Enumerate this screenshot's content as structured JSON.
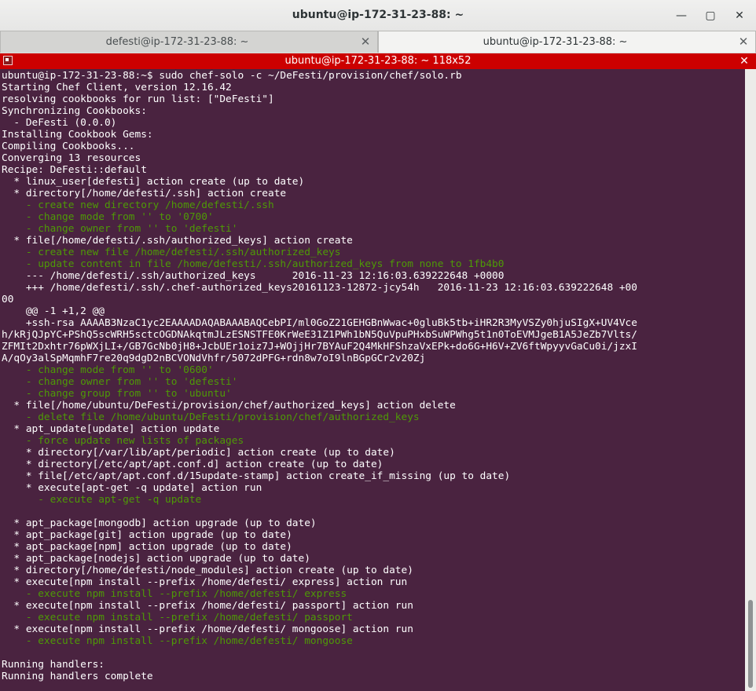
{
  "window": {
    "title": "ubuntu@ip-172-31-23-88: ~"
  },
  "tabs": [
    {
      "label": "defesti@ip-172-31-23-88: ~",
      "active": false
    },
    {
      "label": "ubuntu@ip-172-31-23-88: ~",
      "active": true
    }
  ],
  "terminal": {
    "header": "ubuntu@ip-172-31-23-88: ~ 118x52",
    "lines": [
      {
        "text": "ubuntu@ip-172-31-23-88:~$ sudo chef-solo -c ~/DeFesti/provision/chef/solo.rb",
        "green": false
      },
      {
        "text": "Starting Chef Client, version 12.16.42",
        "green": false
      },
      {
        "text": "resolving cookbooks for run list: [\"DeFesti\"]",
        "green": false
      },
      {
        "text": "Synchronizing Cookbooks:",
        "green": false
      },
      {
        "text": "  - DeFesti (0.0.0)",
        "green": false
      },
      {
        "text": "Installing Cookbook Gems:",
        "green": false
      },
      {
        "text": "Compiling Cookbooks...",
        "green": false
      },
      {
        "text": "Converging 13 resources",
        "green": false
      },
      {
        "text": "Recipe: DeFesti::default",
        "green": false
      },
      {
        "text": "  * linux_user[defesti] action create (up to date)",
        "green": false
      },
      {
        "text": "  * directory[/home/defesti/.ssh] action create",
        "green": false
      },
      {
        "text": "    - create new directory /home/defesti/.ssh",
        "green": true
      },
      {
        "text": "    - change mode from '' to '0700'",
        "green": true
      },
      {
        "text": "    - change owner from '' to 'defesti'",
        "green": true
      },
      {
        "text": "  * file[/home/defesti/.ssh/authorized_keys] action create",
        "green": false
      },
      {
        "text": "    - create new file /home/defesti/.ssh/authorized_keys",
        "green": true
      },
      {
        "text": "    - update content in file /home/defesti/.ssh/authorized_keys from none to 1fb4b0",
        "green": true
      },
      {
        "text": "    --- /home/defesti/.ssh/authorized_keys      2016-11-23 12:16:03.639222648 +0000",
        "green": false
      },
      {
        "text": "    +++ /home/defesti/.ssh/.chef-authorized_keys20161123-12872-jcy54h   2016-11-23 12:16:03.639222648 +00",
        "green": false
      },
      {
        "text": "00",
        "green": false
      },
      {
        "text": "    @@ -1 +1,2 @@",
        "green": false
      },
      {
        "text": "    +ssh-rsa AAAAB3NzaC1yc2EAAAADAQABAAABAQCebPI/ml0GoZ21GEHGBnWwac+0gluBk5tb+iHR2R3MyVSZy0hjuSIgX+UV4Vce",
        "green": false
      },
      {
        "text": "h/kRjQJpYC+PShQ5scWRH5sctcOGDNAkqtmJLzESNSTFE0KrWeE31Z1PWh1bN5QuVpuPHxbSuWPWhg5t1n0ToEVMJgeB1A5JeZb7Vlts/",
        "green": false
      },
      {
        "text": "ZFMIt2Dxhtr76pWXjLI+/GB7GcNb0jH8+JcbUEr1oiz7J+WOjjHr7BYAuF2Q4MkHFShzaVxEPk+do6G+H6V+ZV6ftWpyyvGaCu0i/jzxI",
        "green": false
      },
      {
        "text": "A/qOy3alSpMqmhF7re20q9dgD2nBCVONdVhfr/5072dPFG+rdn8w7oI9lnBGpGCr2v20Zj",
        "green": false
      },
      {
        "text": "    - change mode from '' to '0600'",
        "green": true
      },
      {
        "text": "    - change owner from '' to 'defesti'",
        "green": true
      },
      {
        "text": "    - change group from '' to 'ubuntu'",
        "green": true
      },
      {
        "text": "  * file[/home/ubuntu/DeFesti/provision/chef/authorized_keys] action delete",
        "green": false
      },
      {
        "text": "    - delete file /home/ubuntu/DeFesti/provision/chef/authorized_keys",
        "green": true
      },
      {
        "text": "  * apt_update[update] action update",
        "green": false
      },
      {
        "text": "    - force update new lists of packages",
        "green": true
      },
      {
        "text": "    * directory[/var/lib/apt/periodic] action create (up to date)",
        "green": false
      },
      {
        "text": "    * directory[/etc/apt/apt.conf.d] action create (up to date)",
        "green": false
      },
      {
        "text": "    * file[/etc/apt/apt.conf.d/15update-stamp] action create_if_missing (up to date)",
        "green": false
      },
      {
        "text": "    * execute[apt-get -q update] action run",
        "green": false
      },
      {
        "text": "      - execute apt-get -q update",
        "green": true
      },
      {
        "text": "",
        "green": false
      },
      {
        "text": "  * apt_package[mongodb] action upgrade (up to date)",
        "green": false
      },
      {
        "text": "  * apt_package[git] action upgrade (up to date)",
        "green": false
      },
      {
        "text": "  * apt_package[npm] action upgrade (up to date)",
        "green": false
      },
      {
        "text": "  * apt_package[nodejs] action upgrade (up to date)",
        "green": false
      },
      {
        "text": "  * directory[/home/defesti/node_modules] action create (up to date)",
        "green": false
      },
      {
        "text": "  * execute[npm install --prefix /home/defesti/ express] action run",
        "green": false
      },
      {
        "text": "    - execute npm install --prefix /home/defesti/ express",
        "green": true
      },
      {
        "text": "  * execute[npm install --prefix /home/defesti/ passport] action run",
        "green": false
      },
      {
        "text": "    - execute npm install --prefix /home/defesti/ passport",
        "green": true
      },
      {
        "text": "  * execute[npm install --prefix /home/defesti/ mongoose] action run",
        "green": false
      },
      {
        "text": "    - execute npm install --prefix /home/defesti/ mongoose",
        "green": true
      },
      {
        "text": "",
        "green": false
      },
      {
        "text": "Running handlers:",
        "green": false
      },
      {
        "text": "Running handlers complete",
        "green": false
      }
    ]
  },
  "icons": {
    "minimize": "minimize-icon",
    "maximize": "maximize-icon",
    "close": "close-icon",
    "terminal": "terminal-icon"
  },
  "colors": {
    "terminal_bg": "#4a2340",
    "header_red": "#cc0000",
    "output_green": "#4e9a06"
  }
}
